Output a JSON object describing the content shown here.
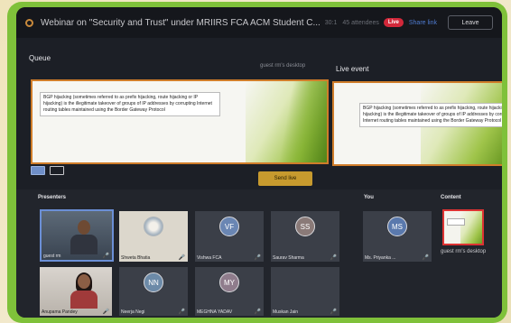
{
  "window": {
    "title": "Webinar on \"Security and Trust\" under MRIIRS FCA ACM Student C...",
    "time": "30:1",
    "attendees": "45 attendees",
    "live_badge": "Live",
    "share_link": "Share link",
    "leave_label": "Leave"
  },
  "queue": {
    "label": "Queue",
    "source": "guest rm's desktop"
  },
  "live": {
    "label": "Live event"
  },
  "slide": {
    "text": "BGP hijacking (sometimes referred to as prefix hijacking, route hijacking or IP hijacking) is the illegitimate takeover of groups of IP addresses by corrupting Internet routing tables maintained using the Border Gateway Protocol"
  },
  "send_live_label": "Send live",
  "sections": {
    "presenters": "Presenters",
    "you": "You",
    "content": "Content"
  },
  "presenters": [
    {
      "name": "guest rm",
      "initials": ""
    },
    {
      "name": "Shweta Bhatia",
      "initials": ""
    },
    {
      "name": "Vishwa FCA",
      "initials": "VF"
    },
    {
      "name": "Saurav Sharma",
      "initials": "SS"
    },
    {
      "name": "Anupama Pandey",
      "initials": ""
    },
    {
      "name": "Neerja Negi",
      "initials": "NN"
    },
    {
      "name": "MEGHNA YADAV",
      "initials": "MY"
    },
    {
      "name": "Muskan Jain",
      "initials": ""
    }
  ],
  "you": {
    "name": "Ms. Priyanka ...",
    "initials": "MS"
  },
  "content": {
    "name": "guest rm's desktop"
  },
  "colors": {
    "accent_orange": "#d07d2a",
    "live_red": "#d2283a",
    "send_live": "#c79a2e",
    "bezel_green": "#7fc13a"
  }
}
